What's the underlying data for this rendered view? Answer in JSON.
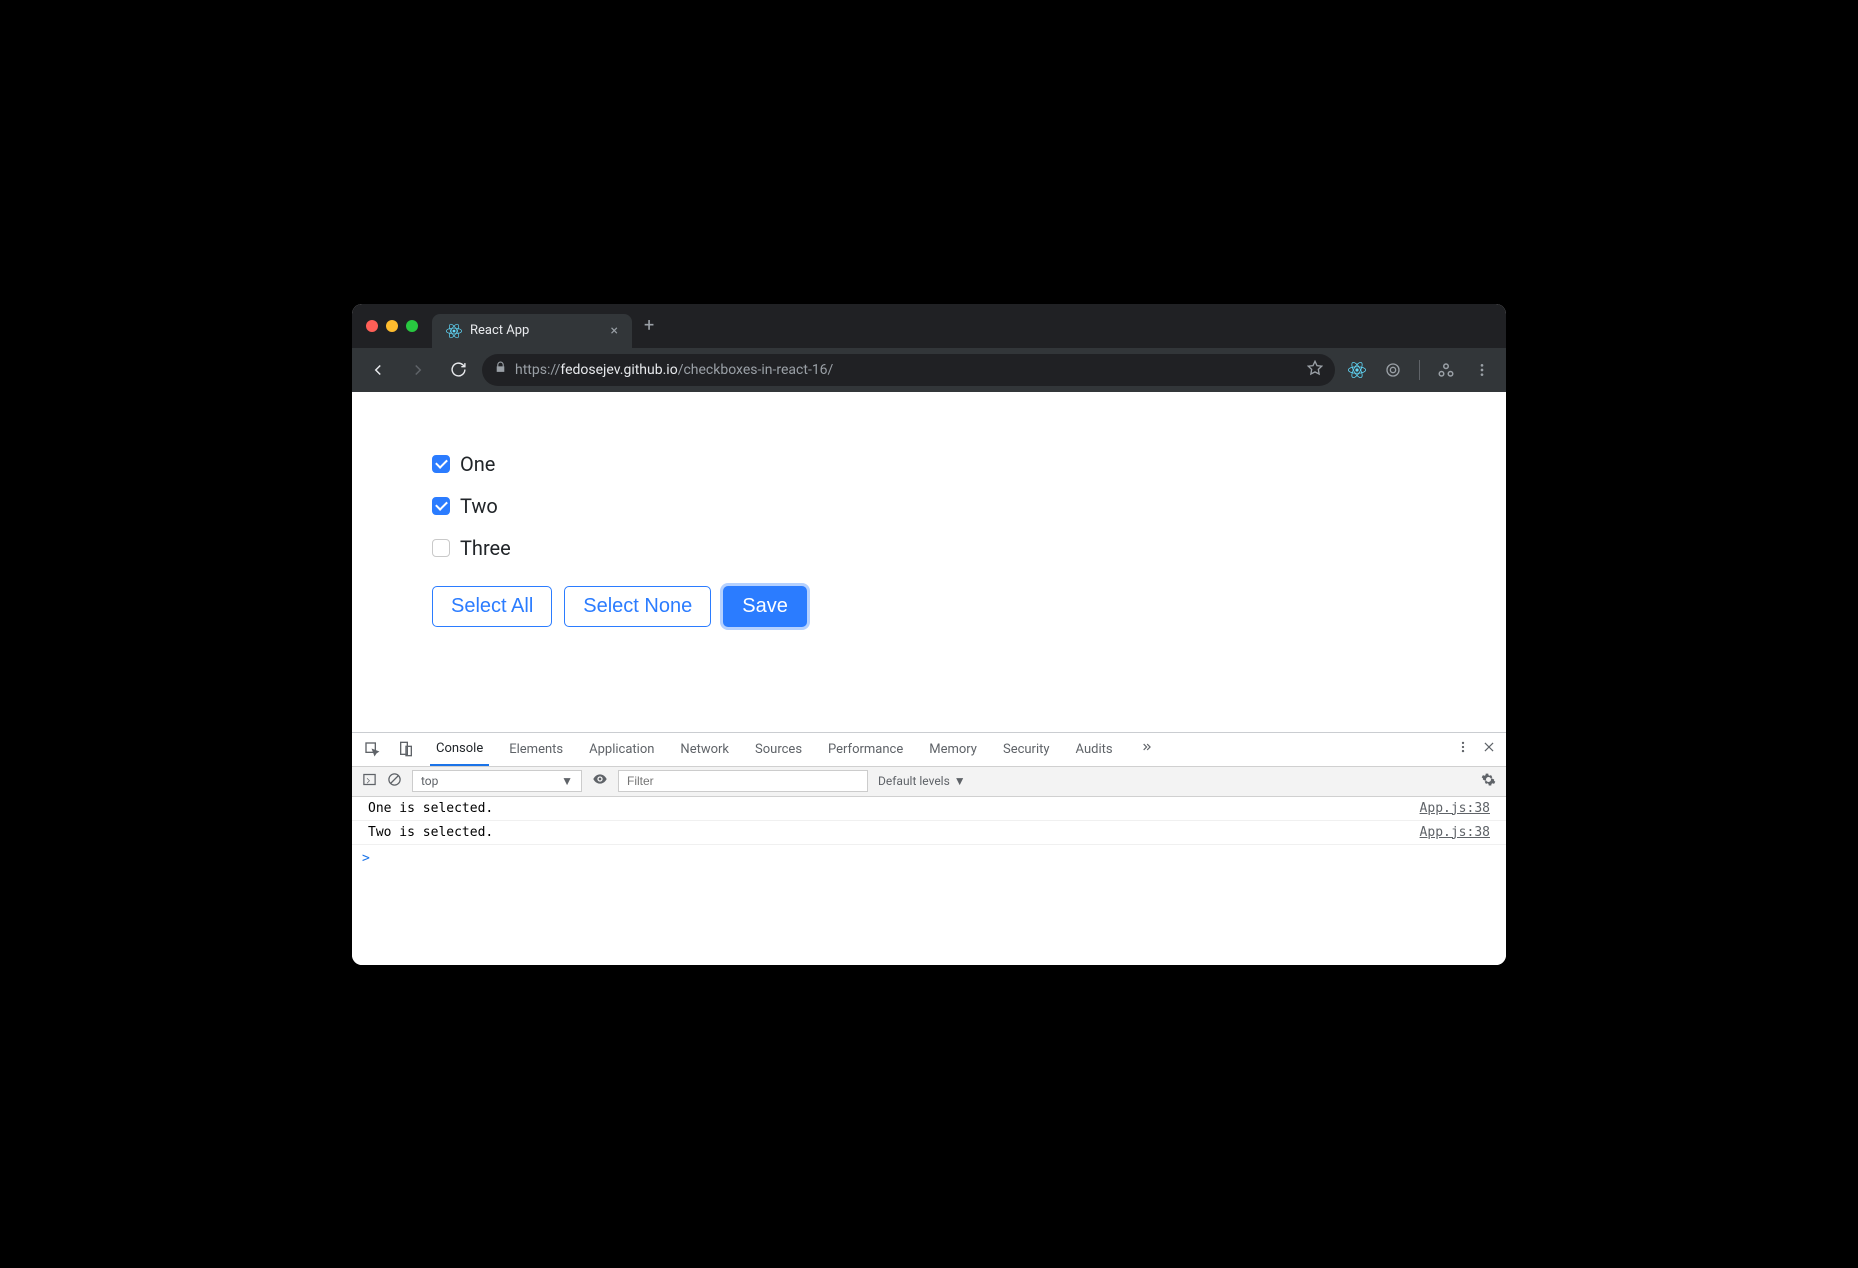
{
  "browser": {
    "tab_title": "React App",
    "url_scheme": "https://",
    "url_host": "fedosejev.github.io",
    "url_path": "/checkboxes-in-react-16/"
  },
  "page": {
    "checkboxes": [
      {
        "label": "One",
        "checked": true
      },
      {
        "label": "Two",
        "checked": true
      },
      {
        "label": "Three",
        "checked": false
      }
    ],
    "buttons": {
      "select_all": "Select All",
      "select_none": "Select None",
      "save": "Save"
    }
  },
  "devtools": {
    "tabs": [
      "Console",
      "Elements",
      "Application",
      "Network",
      "Sources",
      "Performance",
      "Memory",
      "Security",
      "Audits"
    ],
    "active_tab": "Console",
    "context_select": "top",
    "filter_placeholder": "Filter",
    "levels_label": "Default levels",
    "logs": [
      {
        "msg": "One is selected.",
        "src": "App.js:38"
      },
      {
        "msg": "Two is selected.",
        "src": "App.js:38"
      }
    ],
    "prompt": ">"
  }
}
